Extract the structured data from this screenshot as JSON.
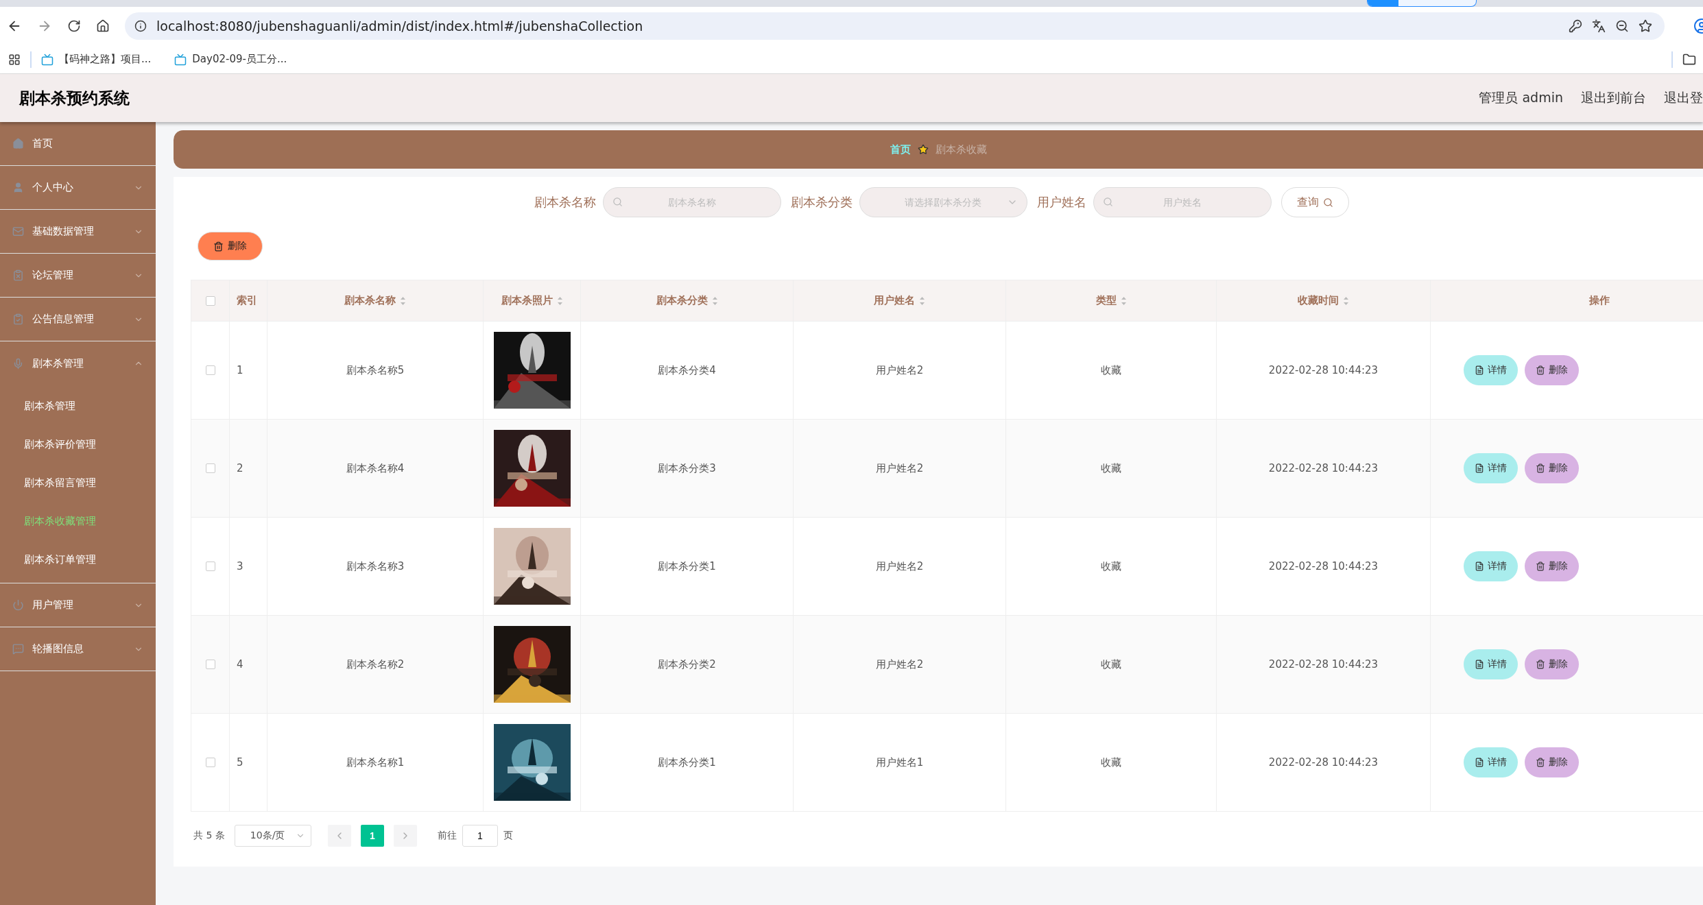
{
  "browser": {
    "url": "localhost:8080/jubenshaguanli/admin/dist/index.html#/jubenshaCollection",
    "bookmarks": [
      "【码神之路】项目...",
      "Day02-09-员工分..."
    ]
  },
  "header": {
    "title": "剧本杀预约系统",
    "links": [
      "管理员 admin",
      "退出到前台",
      "退出登"
    ]
  },
  "sidebar": {
    "items": [
      {
        "label": "首页",
        "kind": "link"
      },
      {
        "label": "个人中心",
        "kind": "menu",
        "expanded": false
      },
      {
        "label": "基础数据管理",
        "kind": "menu",
        "expanded": false
      },
      {
        "label": "论坛管理",
        "kind": "menu",
        "expanded": false
      },
      {
        "label": "公告信息管理",
        "kind": "menu",
        "expanded": false
      },
      {
        "label": "剧本杀管理",
        "kind": "menu",
        "expanded": true,
        "children": [
          {
            "label": "剧本杀管理",
            "selected": false
          },
          {
            "label": "剧本杀评价管理",
            "selected": false
          },
          {
            "label": "剧本杀留言管理",
            "selected": false
          },
          {
            "label": "剧本杀收藏管理",
            "selected": true
          },
          {
            "label": "剧本杀订单管理",
            "selected": false
          }
        ]
      },
      {
        "label": "用户管理",
        "kind": "menu",
        "expanded": false
      },
      {
        "label": "轮播图信息",
        "kind": "menu",
        "expanded": false
      }
    ]
  },
  "breadcrumb": [
    {
      "label": "首页",
      "kind": "link"
    },
    {
      "label": "剧本杀收藏",
      "kind": "current"
    }
  ],
  "search": {
    "fields": [
      {
        "label": "剧本杀名称",
        "placeholder": "剧本杀名称",
        "kind": "text"
      },
      {
        "label": "剧本杀分类",
        "placeholder": "请选择剧本杀分类",
        "kind": "select"
      },
      {
        "label": "用户姓名",
        "placeholder": "用户姓名",
        "kind": "text"
      }
    ],
    "button": "查询"
  },
  "delete_button": "删除",
  "table": {
    "select_all": {
      "checked": false
    },
    "columns": [
      {
        "label": "索引",
        "sortable": false
      },
      {
        "label": "剧本杀名称",
        "sortable": true
      },
      {
        "label": "剧本杀照片",
        "sortable": true
      },
      {
        "label": "剧本杀分类",
        "sortable": true
      },
      {
        "label": "用户姓名",
        "sortable": true
      },
      {
        "label": "类型",
        "sortable": true
      },
      {
        "label": "收藏时间",
        "sortable": true
      },
      {
        "label": "操作",
        "sortable": false
      }
    ],
    "rows": [
      {
        "checked": false,
        "index": "1",
        "name": "剧本杀名称5",
        "photo": {
          "kind": "picture"
        },
        "category": "剧本杀分类4",
        "user": "用户姓名2",
        "type": "收藏",
        "time": "2022-02-28 10:44:23",
        "actions": [
          "详情",
          "删除"
        ]
      },
      {
        "checked": false,
        "index": "2",
        "name": "剧本杀名称4",
        "photo": {
          "kind": "picture"
        },
        "category": "剧本杀分类3",
        "user": "用户姓名2",
        "type": "收藏",
        "time": "2022-02-28 10:44:23",
        "actions": [
          "详情",
          "删除"
        ]
      },
      {
        "checked": false,
        "index": "3",
        "name": "剧本杀名称3",
        "photo": {
          "kind": "picture"
        },
        "category": "剧本杀分类1",
        "user": "用户姓名2",
        "type": "收藏",
        "time": "2022-02-28 10:44:23",
        "actions": [
          "详情",
          "删除"
        ]
      },
      {
        "checked": false,
        "index": "4",
        "name": "剧本杀名称2",
        "photo": {
          "kind": "picture"
        },
        "category": "剧本杀分类2",
        "user": "用户姓名2",
        "type": "收藏",
        "time": "2022-02-28 10:44:23",
        "actions": [
          "详情",
          "删除"
        ]
      },
      {
        "checked": false,
        "index": "5",
        "name": "剧本杀名称1",
        "photo": {
          "kind": "picture"
        },
        "category": "剧本杀分类1",
        "user": "用户姓名1",
        "type": "收藏",
        "time": "2022-02-28 10:44:23",
        "actions": [
          "详情",
          "删除"
        ]
      }
    ]
  },
  "pagination": {
    "total": "共 5 条",
    "page_size": "10条/页",
    "pages": [
      {
        "label": "1",
        "selected": true
      }
    ],
    "goto_label": "前往",
    "goto_value": "1",
    "page_suffix": "页"
  }
}
